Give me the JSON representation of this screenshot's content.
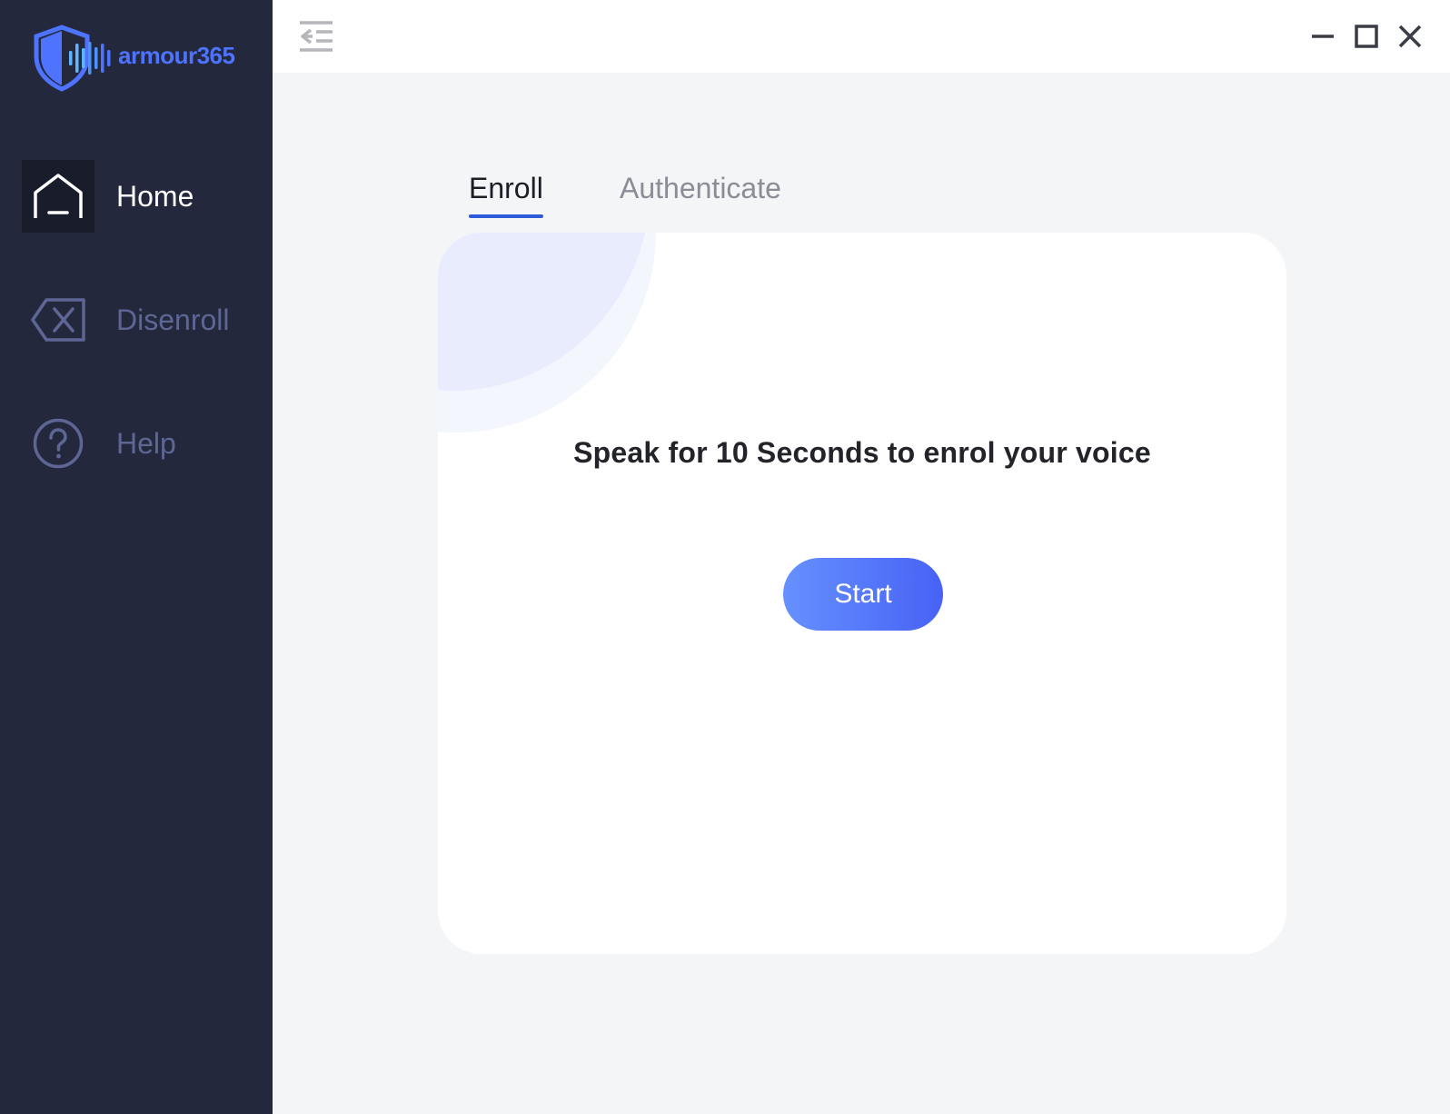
{
  "app": {
    "name": "armour365",
    "brand_color": "#4d73ff"
  },
  "sidebar": {
    "items": [
      {
        "label": "Home",
        "icon": "home-icon",
        "active": true
      },
      {
        "label": "Disenroll",
        "icon": "backspace-x-icon",
        "active": false
      },
      {
        "label": "Help",
        "icon": "help-circle-icon",
        "active": false
      }
    ]
  },
  "topbar": {
    "collapse_icon": "collapse-sidebar-icon",
    "window_controls": [
      "minimize-icon",
      "maximize-icon",
      "close-icon"
    ]
  },
  "main": {
    "tabs": [
      {
        "label": "Enroll",
        "active": true
      },
      {
        "label": "Authenticate",
        "active": false
      }
    ],
    "card": {
      "message": "Speak for 10 Seconds to enrol your voice",
      "start_label": "Start"
    }
  },
  "colors": {
    "sidebar_bg": "#23283d",
    "accent": "#2d5bd8",
    "button_gradient": [
      "#6690ff",
      "#4762f5"
    ]
  }
}
